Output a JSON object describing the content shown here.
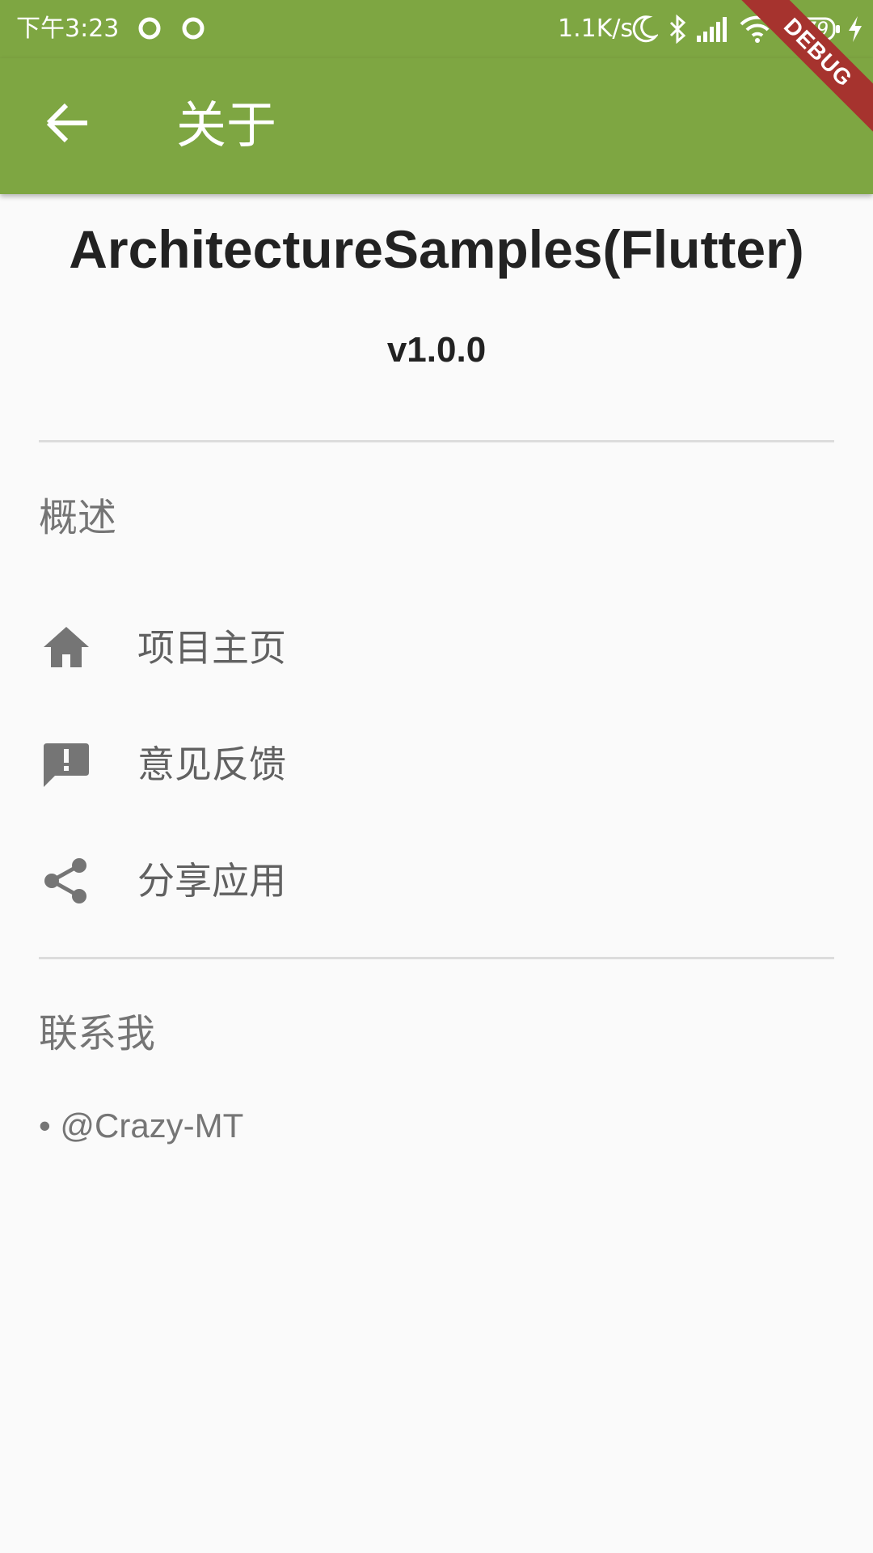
{
  "status_bar": {
    "time": "下午3:23",
    "network_speed": "1.1K/s",
    "battery_level": "79",
    "icons": [
      "notification-ring-icon",
      "notification-ring-icon",
      "moon-icon",
      "bluetooth-icon",
      "signal-icon",
      "wifi-icon",
      "battery-icon",
      "charging-icon"
    ]
  },
  "app_bar": {
    "title": "关于",
    "back_icon": "arrow-back-icon",
    "color": "#7ea642"
  },
  "debug_banner": {
    "label": "DEBUG",
    "color": "#a6332e"
  },
  "header": {
    "app_name": "ArchitectureSamples(Flutter)",
    "version": "v1.0.0"
  },
  "overview": {
    "title": "概述",
    "items": [
      {
        "label": "项目主页",
        "icon": "home-icon"
      },
      {
        "label": "意见反馈",
        "icon": "feedback-icon"
      },
      {
        "label": "分享应用",
        "icon": "share-icon"
      }
    ]
  },
  "contact": {
    "title": "联系我",
    "items": [
      "• @Crazy-MT"
    ]
  }
}
